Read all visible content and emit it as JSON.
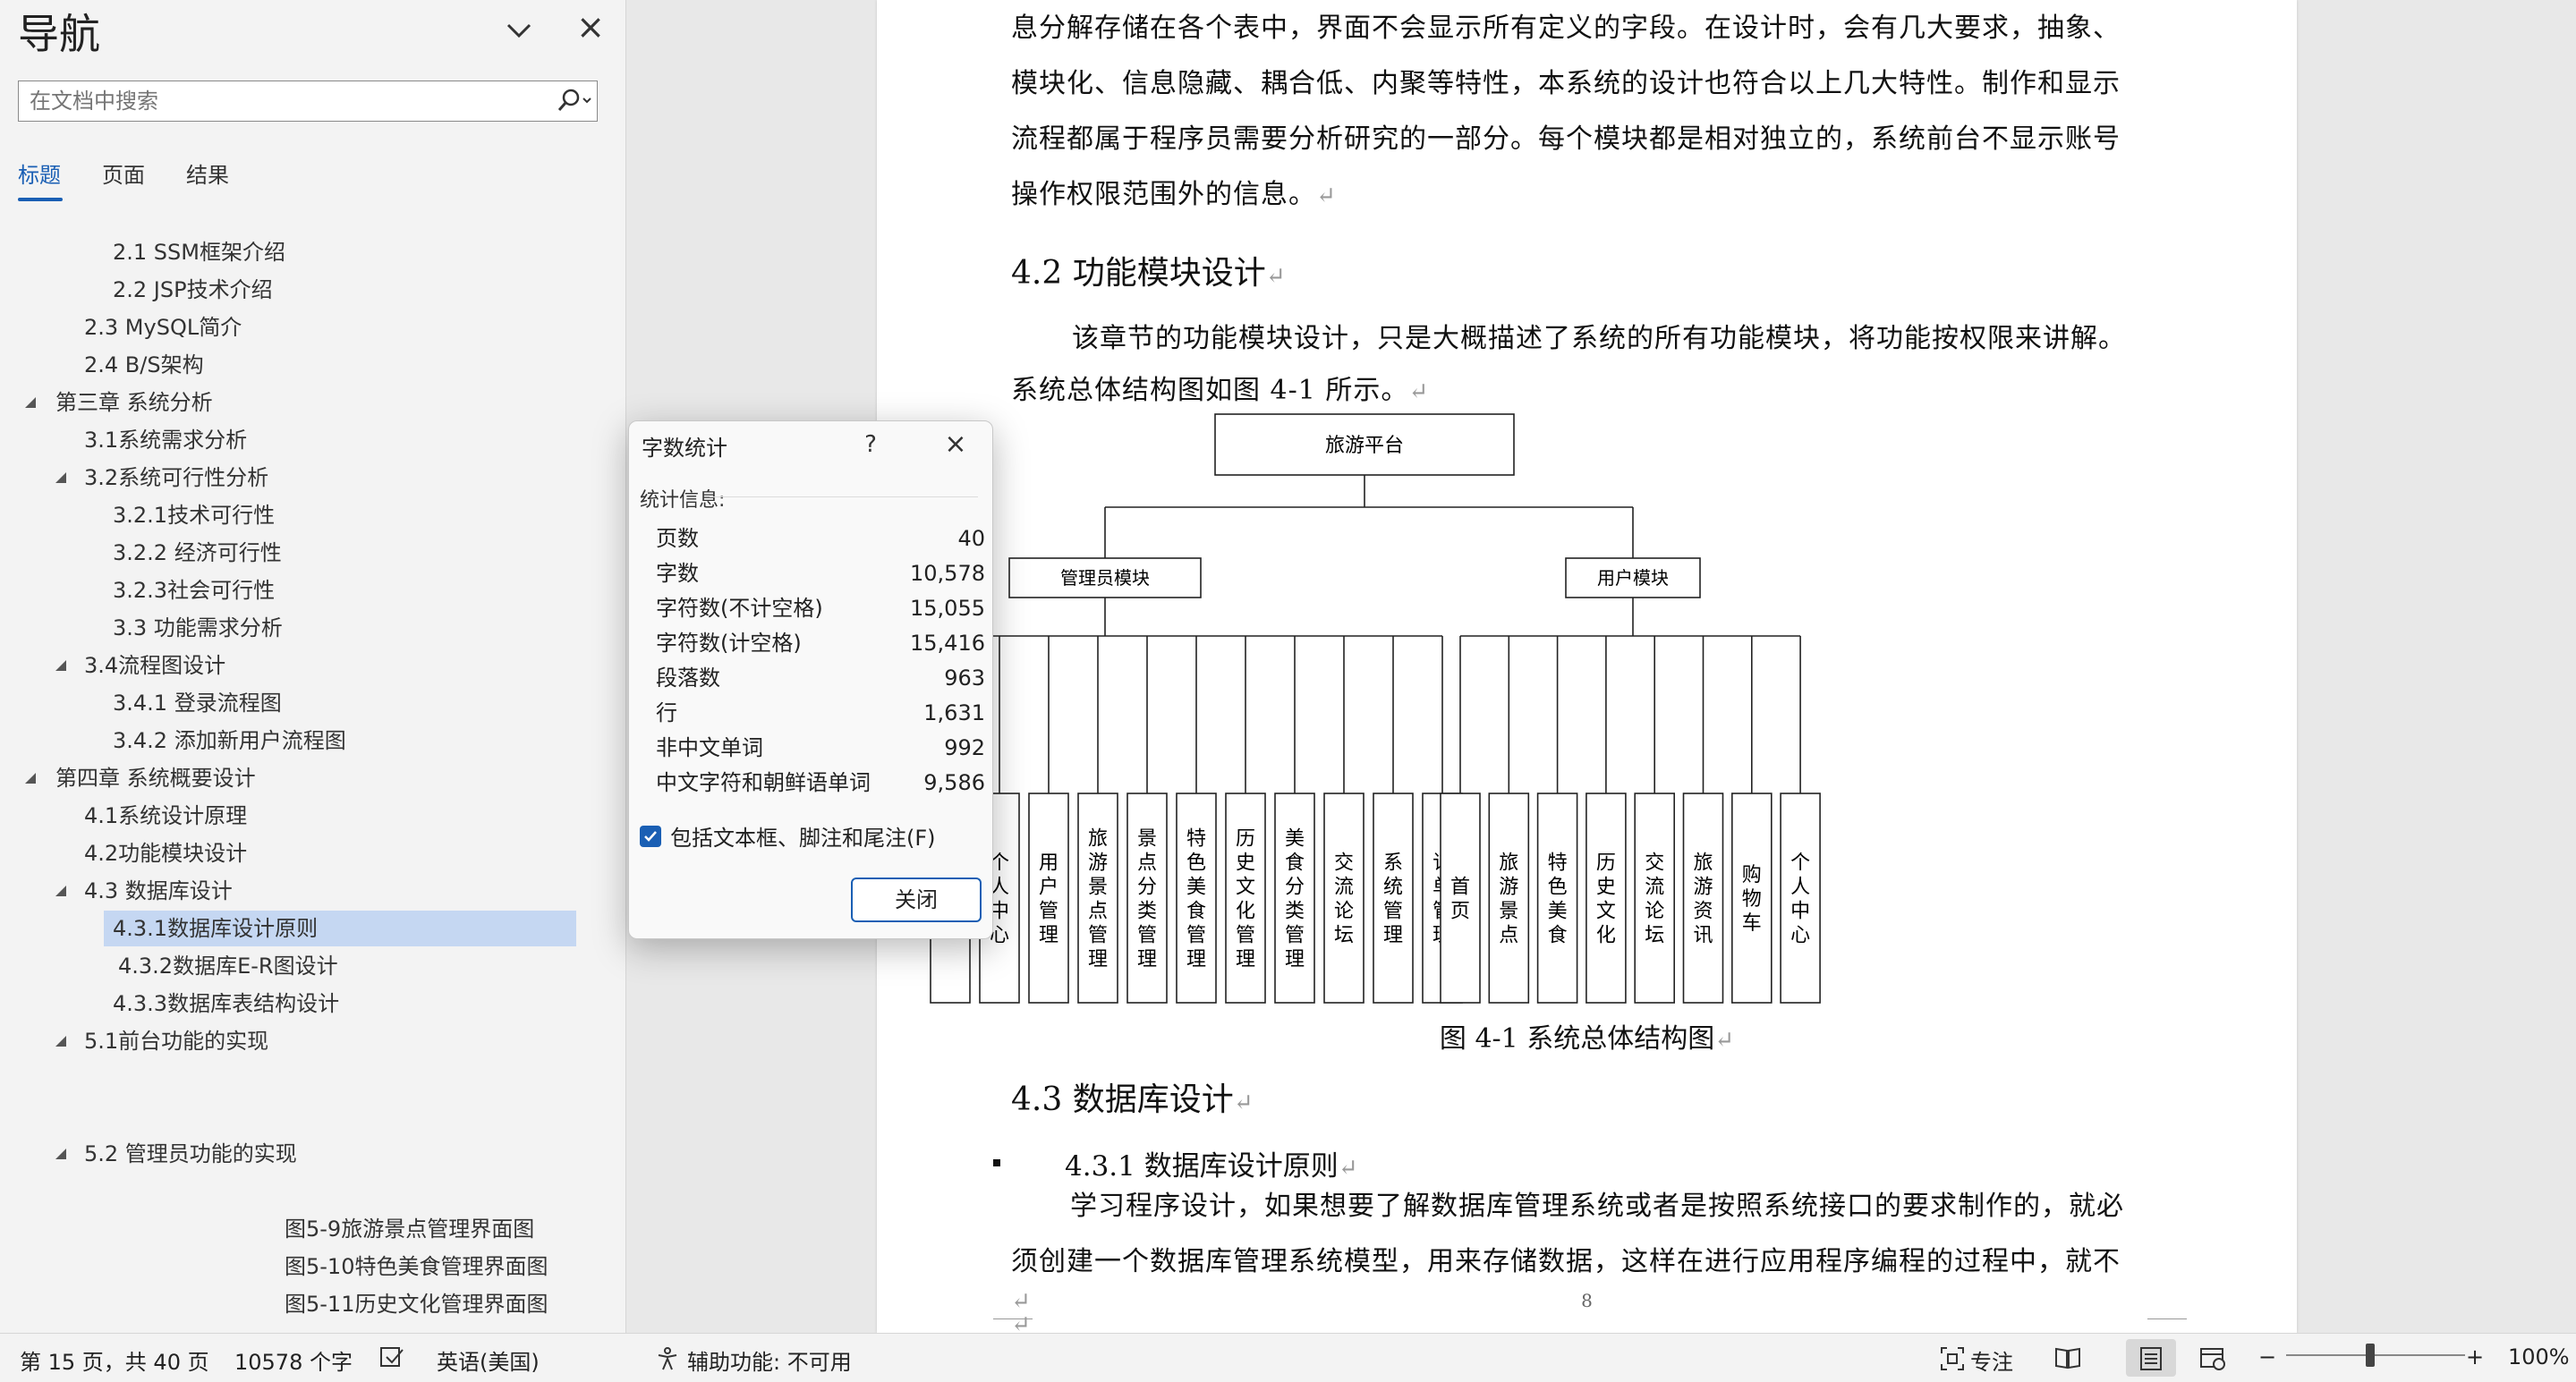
{
  "nav": {
    "title": "导航",
    "search_placeholder": "在文档中搜索",
    "tabs": [
      "标题",
      "页面",
      "结果"
    ],
    "items": [
      {
        "label": "2.1 SSM框架介绍"
      },
      {
        "label": "2.2 JSP技术介绍"
      },
      {
        "label": "2.3 MySQL简介"
      },
      {
        "label": "2.4 B/S架构"
      },
      {
        "label": "第三章 系统分析"
      },
      {
        "label": "3.1系统需求分析"
      },
      {
        "label": "3.2系统可行性分析"
      },
      {
        "label": "3.2.1技术可行性"
      },
      {
        "label": "3.2.2 经济可行性"
      },
      {
        "label": "3.2.3社会可行性"
      },
      {
        "label": "3.3 功能需求分析"
      },
      {
        "label": "3.4流程图设计"
      },
      {
        "label": "3.4.1 登录流程图"
      },
      {
        "label": "3.4.2 添加新用户流程图"
      },
      {
        "label": "第四章 系统概要设计"
      },
      {
        "label": "4.1系统设计原理"
      },
      {
        "label": "4.2功能模块设计"
      },
      {
        "label": "4.3 数据库设计"
      },
      {
        "label": "4.3.1数据库设计原则"
      },
      {
        "label": "4.3.2数据库E-R图设计"
      },
      {
        "label": "4.3.3数据库表结构设计"
      },
      {
        "label": "5.1前台功能的实现"
      },
      {
        "label": "5.2 管理员功能的实现"
      },
      {
        "label": "图5-9旅游景点管理界面图"
      },
      {
        "label": "图5-10特色美食管理界面图"
      },
      {
        "label": "图5-11历史文化管理界面图"
      }
    ]
  },
  "document": {
    "para1_line1": "息分解存储在各个表中，界面不会显示所有定义的字段。在设计时，会有几大要求，抽象、",
    "para1_line2": "模块化、信息隐藏、耦合低、内聚等特性，本系统的设计也符合以上几大特性。制作和显示",
    "para1_line3": "流程都属于程序员需要分析研究的一部分。每个模块都是相对独立的，系统前台不显示账号",
    "para1_line4": "操作权限范围外的信息。",
    "heading_42": "4.2 功能模块设计",
    "para2_line1": "该章节的功能模块设计，只是大概描述了系统的所有功能模块，将功能按权限来讲解。",
    "para2_line2": "系统总体结构图如图 4-1 所示。",
    "figure_caption": "图 4-1  系统总体结构图",
    "heading_43": "4.3  数据库设计",
    "heading_431": "4.3.1 数据库设计原则",
    "para3_line1": "学习程序设计，如果想要了解数据库管理系统或者是按照系统接口的要求制作的，就必",
    "para3_line2": "须创建一个数据库管理系统模型，用来存储数据，这样在进行应用程序编程的过程中，就不",
    "page_number": "8"
  },
  "diagram": {
    "root": "旅游平台",
    "admin_module": "管理员模块",
    "user_module": "用户模块",
    "admin_leaves": [
      "首页",
      "个人中心",
      "用户管理",
      "旅游景点管理",
      "景点分类管理",
      "特色美食管理",
      "历史文化管理",
      "美食分类管理",
      "交流论坛",
      "系统管理",
      "订单管理"
    ],
    "user_leaves": [
      "首页",
      "旅游景点",
      "特色美食",
      "历史文化",
      "交流论坛",
      "旅游资讯",
      "购物车",
      "个人中心"
    ]
  },
  "dialog": {
    "title": "字数统计",
    "help": "?",
    "section": "统计信息:",
    "rows": [
      {
        "label": "页数",
        "value": "40"
      },
      {
        "label": "字数",
        "value": "10,578"
      },
      {
        "label": "字符数(不计空格)",
        "value": "15,055"
      },
      {
        "label": "字符数(计空格)",
        "value": "15,416"
      },
      {
        "label": "段落数",
        "value": "963"
      },
      {
        "label": "行",
        "value": "1,631"
      },
      {
        "label": "非中文单词",
        "value": "992"
      },
      {
        "label": "中文字符和朝鲜语单词",
        "value": "9,586"
      }
    ],
    "checkbox_label": "包括文本框、脚注和尾注(F)",
    "close_button": "关闭"
  },
  "status": {
    "page_info": "第 15 页，共 40 页",
    "word_count": "10578 个字",
    "language": "英语(美国)",
    "accessibility": "辅助功能: 不可用",
    "focus": "专注",
    "zoom_level": "100%",
    "zoom_minus": "−",
    "zoom_plus": "+"
  },
  "colors": {
    "accent": "#1a5fb4",
    "selected_nav": "#c5d7f2"
  }
}
